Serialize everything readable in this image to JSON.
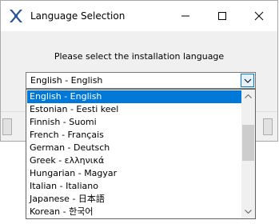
{
  "window": {
    "title": "Language Selection",
    "icon": "installer-x-logo-icon",
    "controls": [
      "minimize-icon",
      "maximize-icon",
      "close-icon"
    ]
  },
  "prompt": "Please select the installation language",
  "combo": {
    "selected": "English - English"
  },
  "dropdown": {
    "items": [
      {
        "label": "English - English",
        "selected": true
      },
      {
        "label": "Estonian - Eesti keel",
        "selected": false
      },
      {
        "label": "Finnish - Suomi",
        "selected": false
      },
      {
        "label": "French - Français",
        "selected": false
      },
      {
        "label": "German - Deutsch",
        "selected": false
      },
      {
        "label": "Greek - ελληνικά",
        "selected": false
      },
      {
        "label": "Hungarian - Magyar",
        "selected": false
      },
      {
        "label": "Italian - Italiano",
        "selected": false
      },
      {
        "label": "Japanese - 日本語",
        "selected": false
      },
      {
        "label": "Korean - 한국어",
        "selected": false
      }
    ]
  },
  "colors": {
    "selection": "#0078d7",
    "logo": "#2b579a"
  }
}
